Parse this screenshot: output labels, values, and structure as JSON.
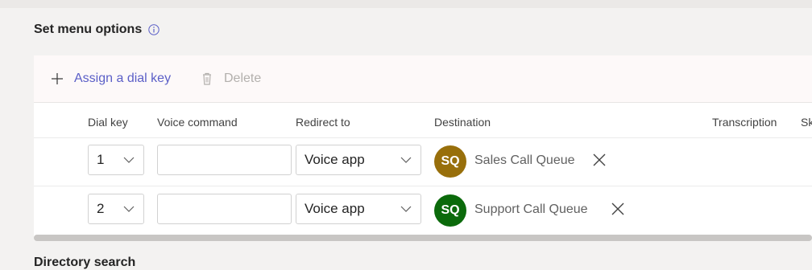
{
  "section": {
    "title": "Set menu options",
    "info_icon": "info-icon",
    "next_title": "Directory search"
  },
  "toolbar": {
    "assign_label": "Assign a dial key",
    "assign_icon": "plus-icon",
    "delete_label": "Delete",
    "delete_icon": "trash-icon"
  },
  "table": {
    "columns": [
      "Dial key",
      "Voice command",
      "Redirect to",
      "Destination",
      "Transcription",
      "Sk"
    ],
    "rows": [
      {
        "dial_key": "1",
        "voice_command": "",
        "redirect_to": "Voice app",
        "avatar_initials": "SQ",
        "avatar_color": "#986f0b",
        "destination": "Sales Call Queue"
      },
      {
        "dial_key": "2",
        "voice_command": "",
        "redirect_to": "Voice app",
        "avatar_initials": "SQ",
        "avatar_color": "#0b6a0b",
        "destination": "Support Call Queue"
      }
    ]
  },
  "colors": {
    "accent": "#5b5fc7",
    "disabled": "#b3b0ad"
  }
}
